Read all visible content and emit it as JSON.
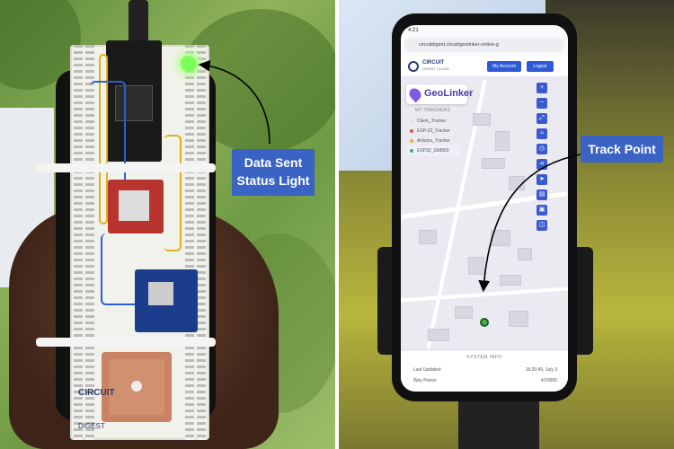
{
  "annotations": {
    "status_light": "Data Sent\nStatus Light",
    "track_point": "Track Point"
  },
  "board_logo": {
    "title": "CIRCUIT",
    "subtitle": "DIGEST"
  },
  "phone": {
    "status_time": "4:21",
    "url": "circuitdigest.cloud/geolinker-online-g",
    "brand": "CIRCUIT",
    "brand_sub": "DIGEST CLOUD",
    "my_account_label": "My Account",
    "logout_label": "Logout",
    "geolinker_label": "GeoLinker",
    "trackers_title": "MY TRACKERS",
    "trackers": [
      {
        "name": "Client_Tracker",
        "color": "#e2e2e2"
      },
      {
        "name": "ESP-32_Tracker",
        "color": "#d9534f"
      },
      {
        "name": "Arduino_Tracker",
        "color": "#e6b73d"
      },
      {
        "name": "ESP32_SIM800",
        "color": "#4caf50"
      }
    ],
    "system_info": {
      "title": "SYSTEM INFO",
      "last_updated_label": "Last Updated:",
      "last_updated_value": "16:20:49, July 3",
      "way_points_label": "Way Points:",
      "way_points_value": "4/10000"
    }
  },
  "colors": {
    "callout": "#3a63c4",
    "led": "#7dff5a",
    "track_point": "#4caf50"
  }
}
